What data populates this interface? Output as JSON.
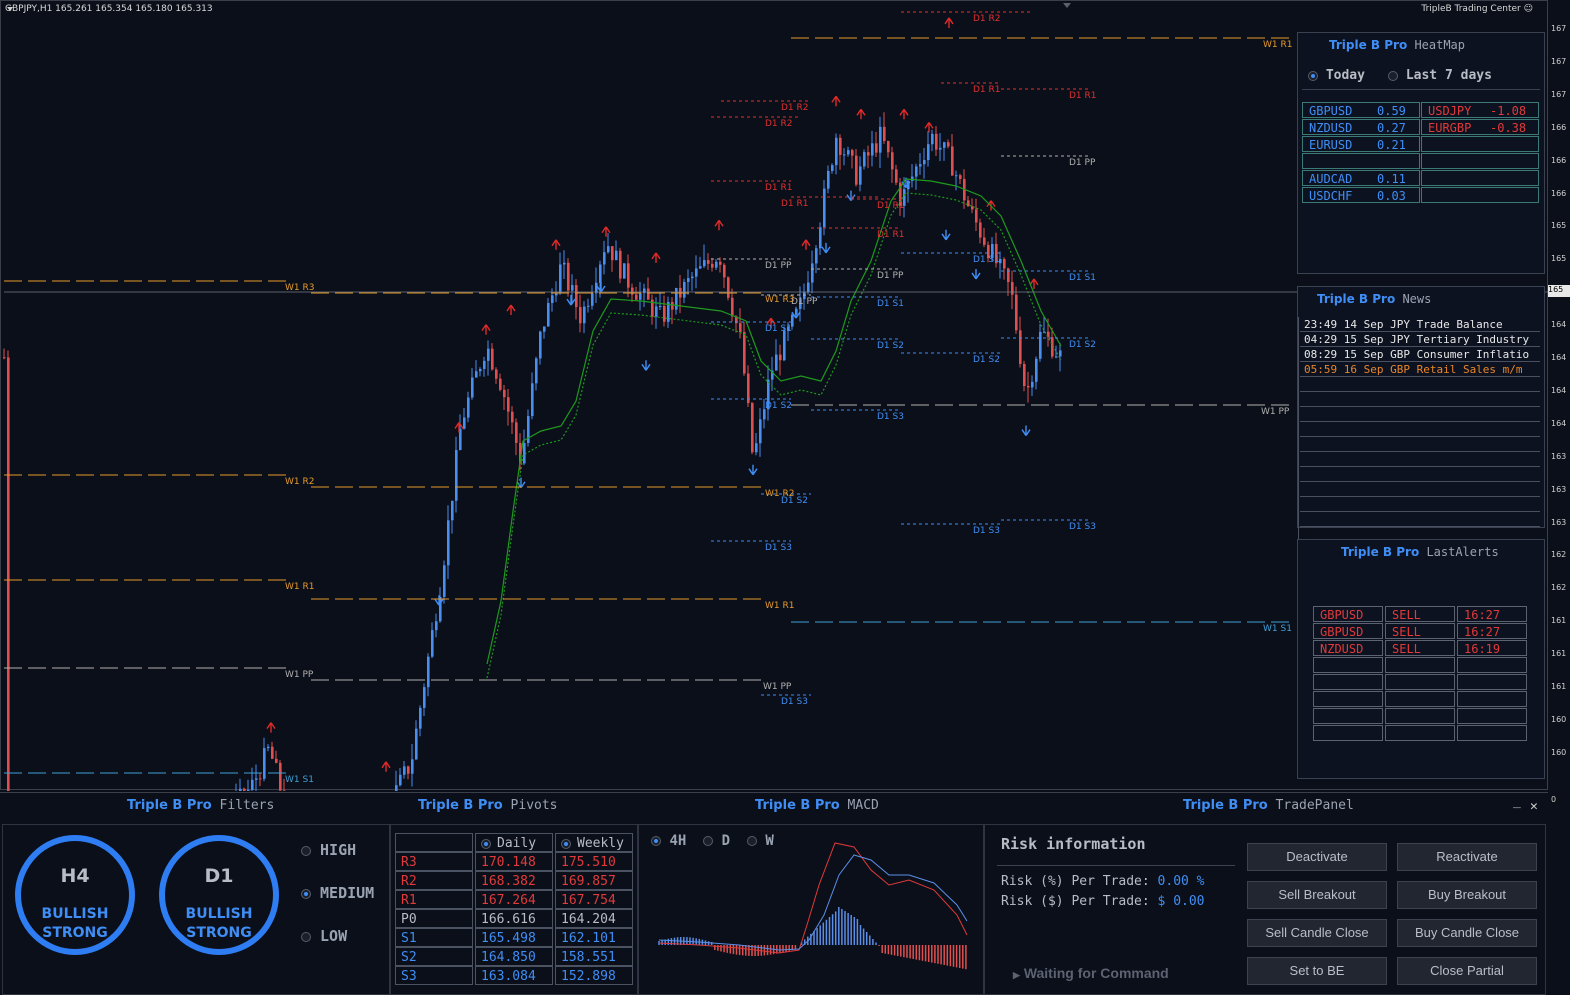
{
  "chart": {
    "symbol_info": "GBPJPY,H1  165.261 165.354 165.180 165.313",
    "brand": "TripleB Trading Center",
    "y_ticks": [
      "167",
      "167",
      "167",
      "166",
      "166",
      "166",
      "165",
      "165",
      "165",
      "164",
      "164",
      "164",
      "164",
      "163",
      "163",
      "163",
      "162",
      "162",
      "161",
      "161",
      "161",
      "160",
      "160"
    ],
    "y_tick_current": "165",
    "y_tick_last": "0",
    "levels": [
      {
        "label": "W1 R1",
        "color": "#e59a2a"
      },
      {
        "label": "D1 R2",
        "color": "#e03030"
      },
      {
        "label": "D1 R1",
        "color": "#e03030"
      },
      {
        "label": "D1 PP",
        "color": "#b0b0b0"
      },
      {
        "label": "D1 S1",
        "color": "#3f8ef5"
      },
      {
        "label": "D1 S2",
        "color": "#3f8ef5"
      },
      {
        "label": "D1 S3",
        "color": "#3f8ef5"
      },
      {
        "label": "W1 R3",
        "color": "#e59a2a"
      },
      {
        "label": "W1 R2",
        "color": "#e59a2a"
      },
      {
        "label": "W1 PP",
        "color": "#b0b0b0"
      },
      {
        "label": "W1 S1",
        "color": "#3fa0d8"
      }
    ]
  },
  "heatmap": {
    "brand": "Triple B Pro",
    "name": "HeatMap",
    "options": [
      "Today",
      "Last 7 days"
    ],
    "selected": "Today",
    "left": [
      {
        "pair": "GBPUSD",
        "val": "0.59"
      },
      {
        "pair": "NZDUSD",
        "val": "0.27"
      },
      {
        "pair": "EURUSD",
        "val": "0.21"
      },
      {
        "pair": "",
        "val": ""
      },
      {
        "pair": "AUDCAD",
        "val": "0.11"
      },
      {
        "pair": "USDCHF",
        "val": "0.03"
      }
    ],
    "right": [
      {
        "pair": "USDJPY",
        "val": "-1.08"
      },
      {
        "pair": "EURGBP",
        "val": "-0.38"
      }
    ]
  },
  "news": {
    "brand": "Triple B Pro",
    "name": "News",
    "items": [
      {
        "text": "23:49 14 Sep JPY Trade Balance",
        "color": "#e8e8e8"
      },
      {
        "text": "04:29 15 Sep JPY Tertiary Industry",
        "color": "#e8e8e8"
      },
      {
        "text": "08:29 15 Sep GBP Consumer Inflatio",
        "color": "#e8e8e8"
      },
      {
        "text": "05:59 16 Sep GBP Retail Sales m/m",
        "color": "#e8862a"
      }
    ]
  },
  "alerts": {
    "brand": "Triple B Pro",
    "name": "LastAlerts",
    "rows": [
      {
        "pair": "GBPUSD",
        "side": "SELL",
        "time": "16:27"
      },
      {
        "pair": "GBPUSD",
        "side": "SELL",
        "time": "16:27"
      },
      {
        "pair": "NZDUSD",
        "side": "SELL",
        "time": "16:19"
      }
    ]
  },
  "filters": {
    "brand": "Triple B Pro",
    "name": "Filters",
    "rings": [
      {
        "tf": "H4",
        "line1": "BULLISH",
        "line2": "STRONG"
      },
      {
        "tf": "D1",
        "line1": "BULLISH",
        "line2": "STRONG"
      }
    ],
    "levels": [
      "HIGH",
      "MEDIUM",
      "LOW"
    ],
    "selected": "MEDIUM"
  },
  "pivots": {
    "brand": "Triple B Pro",
    "name": "Pivots",
    "headers": [
      "Daily",
      "Weekly"
    ],
    "rows": [
      {
        "k": "R3",
        "d": "170.148",
        "w": "175.510",
        "c": "#e03a3a"
      },
      {
        "k": "R2",
        "d": "168.382",
        "w": "169.857",
        "c": "#e03a3a"
      },
      {
        "k": "R1",
        "d": "167.264",
        "w": "167.754",
        "c": "#e03a3a"
      },
      {
        "k": "P0",
        "d": "166.616",
        "w": "164.204",
        "c": "#b8bcc4"
      },
      {
        "k": "S1",
        "d": "165.498",
        "w": "162.101",
        "c": "#3f8ef5"
      },
      {
        "k": "S2",
        "d": "164.850",
        "w": "158.551",
        "c": "#3f8ef5"
      },
      {
        "k": "S3",
        "d": "163.084",
        "w": "152.898",
        "c": "#3f8ef5"
      }
    ]
  },
  "macd": {
    "brand": "Triple B Pro",
    "name": "MACD",
    "tfs": [
      "4H",
      "D",
      "W"
    ],
    "selected": "4H"
  },
  "trade": {
    "brand": "Triple B Pro",
    "name": "TradePanel",
    "risk_title": "Risk information",
    "risk_pct_label": "Risk (%) Per Trade:",
    "risk_pct_val": "0.00 %",
    "risk_usd_label": "Risk ($) Per Trade:",
    "risk_usd_val": "$ 0.00",
    "status": "Waiting for Command",
    "buttons": [
      "Deactivate",
      "Reactivate",
      "Sell Breakout",
      "Buy Breakout",
      "Sell Candle Close",
      "Buy Candle Close",
      "Set to BE",
      "Close Partial"
    ],
    "min_icon": "_",
    "close_icon": "✕"
  }
}
